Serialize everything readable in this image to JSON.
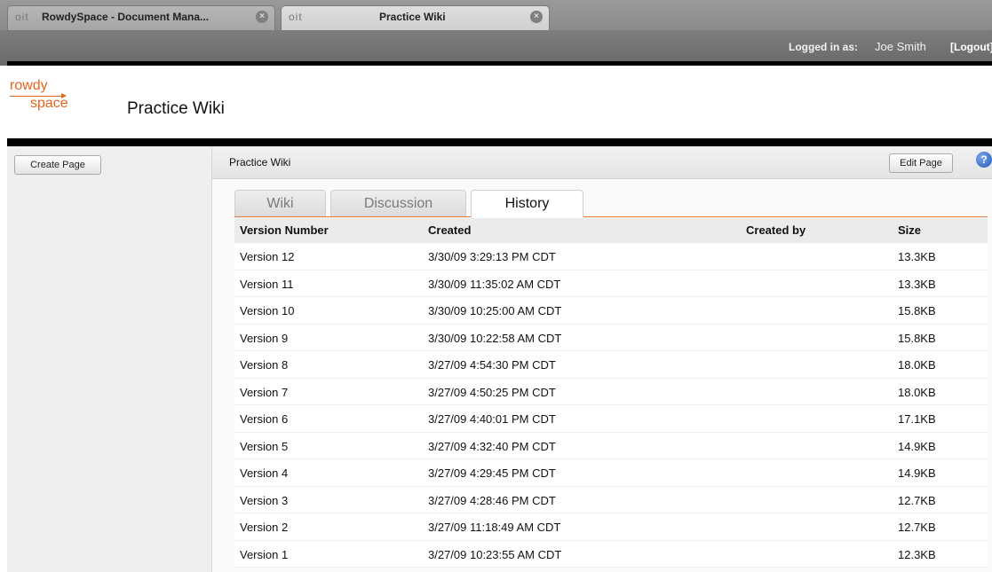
{
  "browser": {
    "tabs": [
      {
        "favicon": "oit",
        "label": "RowdySpace - Document Mana...",
        "active": false
      },
      {
        "favicon": "oit",
        "label": "Practice Wiki",
        "active": true
      }
    ]
  },
  "loginbar": {
    "logged_in_label": "Logged in as:",
    "user_name": "Joe Smith",
    "logout_label": "[Logout]"
  },
  "header": {
    "logo_top": "rowdy",
    "logo_bottom": "space",
    "title": "Practice Wiki"
  },
  "sidebar": {
    "create_page_label": "Create Page"
  },
  "contentbar": {
    "breadcrumb": "Practice Wiki",
    "edit_page_label": "Edit Page",
    "help_icon": "?"
  },
  "tabs": [
    {
      "label": "Wiki",
      "active": false
    },
    {
      "label": "Discussion",
      "active": false
    },
    {
      "label": "History",
      "active": true
    }
  ],
  "history": {
    "columns": [
      "Version Number",
      "Created",
      "Created by",
      "Size"
    ],
    "rows": [
      {
        "version": "Version 12",
        "created": "3/30/09 3:29:13 PM CDT",
        "created_by": "",
        "size": "13.3KB"
      },
      {
        "version": "Version 11",
        "created": "3/30/09 11:35:02 AM CDT",
        "created_by": "",
        "size": "13.3KB"
      },
      {
        "version": "Version 10",
        "created": "3/30/09 10:25:00 AM CDT",
        "created_by": "",
        "size": "15.8KB"
      },
      {
        "version": "Version 9",
        "created": "3/30/09 10:22:58 AM CDT",
        "created_by": "",
        "size": "15.8KB"
      },
      {
        "version": "Version 8",
        "created": "3/27/09 4:54:30 PM CDT",
        "created_by": "",
        "size": "18.0KB"
      },
      {
        "version": "Version 7",
        "created": "3/27/09 4:50:25 PM CDT",
        "created_by": "",
        "size": "18.0KB"
      },
      {
        "version": "Version 6",
        "created": "3/27/09 4:40:01 PM CDT",
        "created_by": "",
        "size": "17.1KB"
      },
      {
        "version": "Version 5",
        "created": "3/27/09 4:32:40 PM CDT",
        "created_by": "",
        "size": "14.9KB"
      },
      {
        "version": "Version 4",
        "created": "3/27/09 4:29:45 PM CDT",
        "created_by": "",
        "size": "14.9KB"
      },
      {
        "version": "Version 3",
        "created": "3/27/09 4:28:46 PM CDT",
        "created_by": "",
        "size": "12.7KB"
      },
      {
        "version": "Version 2",
        "created": "3/27/09 11:18:49 AM CDT",
        "created_by": "",
        "size": "12.7KB"
      },
      {
        "version": "Version 1",
        "created": "3/27/09 10:23:55 AM CDT",
        "created_by": "",
        "size": "12.3KB"
      }
    ]
  },
  "colors": {
    "accent": "#e8641b",
    "help_blue": "#2356b8"
  }
}
